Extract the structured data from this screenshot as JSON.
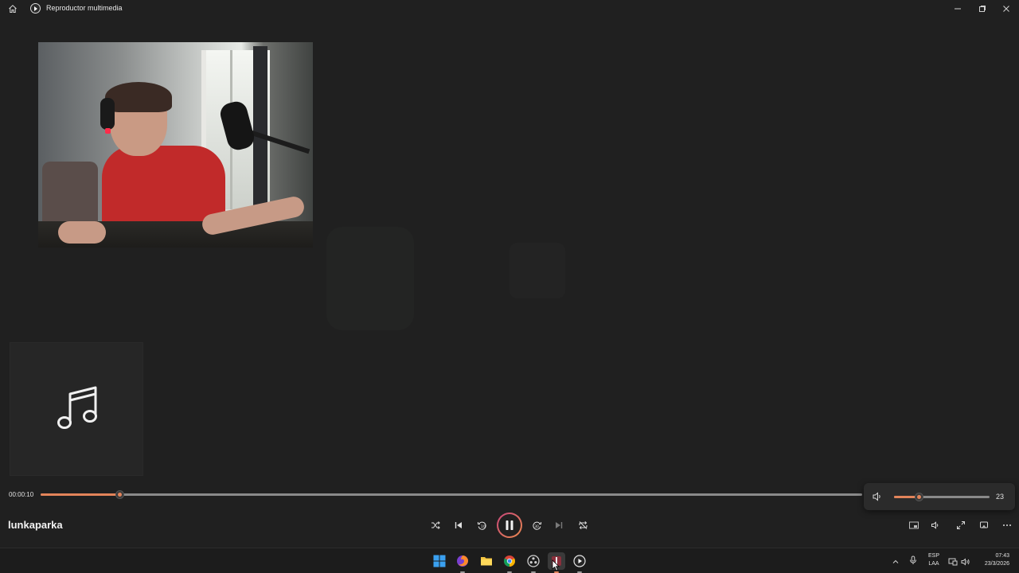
{
  "window": {
    "title": "Reproductor multimedia",
    "controls": [
      "minimize-icon",
      "restore-icon",
      "close-icon"
    ]
  },
  "player": {
    "track_title": "lunkaparka",
    "current_time": "00:00:10",
    "progress_fraction": 0.096,
    "volume_value": "23",
    "volume_fraction": 0.26,
    "accent_color": "#e3845a",
    "play_state": "playing"
  },
  "transport": [
    {
      "name": "shuffle-icon"
    },
    {
      "name": "previous-icon"
    },
    {
      "name": "rewind-10-icon"
    },
    {
      "name": "pause-icon"
    },
    {
      "name": "forward-30-icon"
    },
    {
      "name": "next-icon"
    },
    {
      "name": "repeat-icon"
    }
  ],
  "right_controls": [
    "miniplayer-icon",
    "volume-icon",
    "fullscreen-icon",
    "cast-icon",
    "more-options-icon"
  ],
  "taskbar": {
    "apps": [
      "start-icon",
      "firefox-icon",
      "file-explorer-icon",
      "chrome-icon",
      "obs-icon",
      "app-active-icon",
      "media-player-icon"
    ],
    "language_top": "ESP",
    "language_bottom": "LAA",
    "time": "07:43",
    "date": "23/3/2026"
  }
}
